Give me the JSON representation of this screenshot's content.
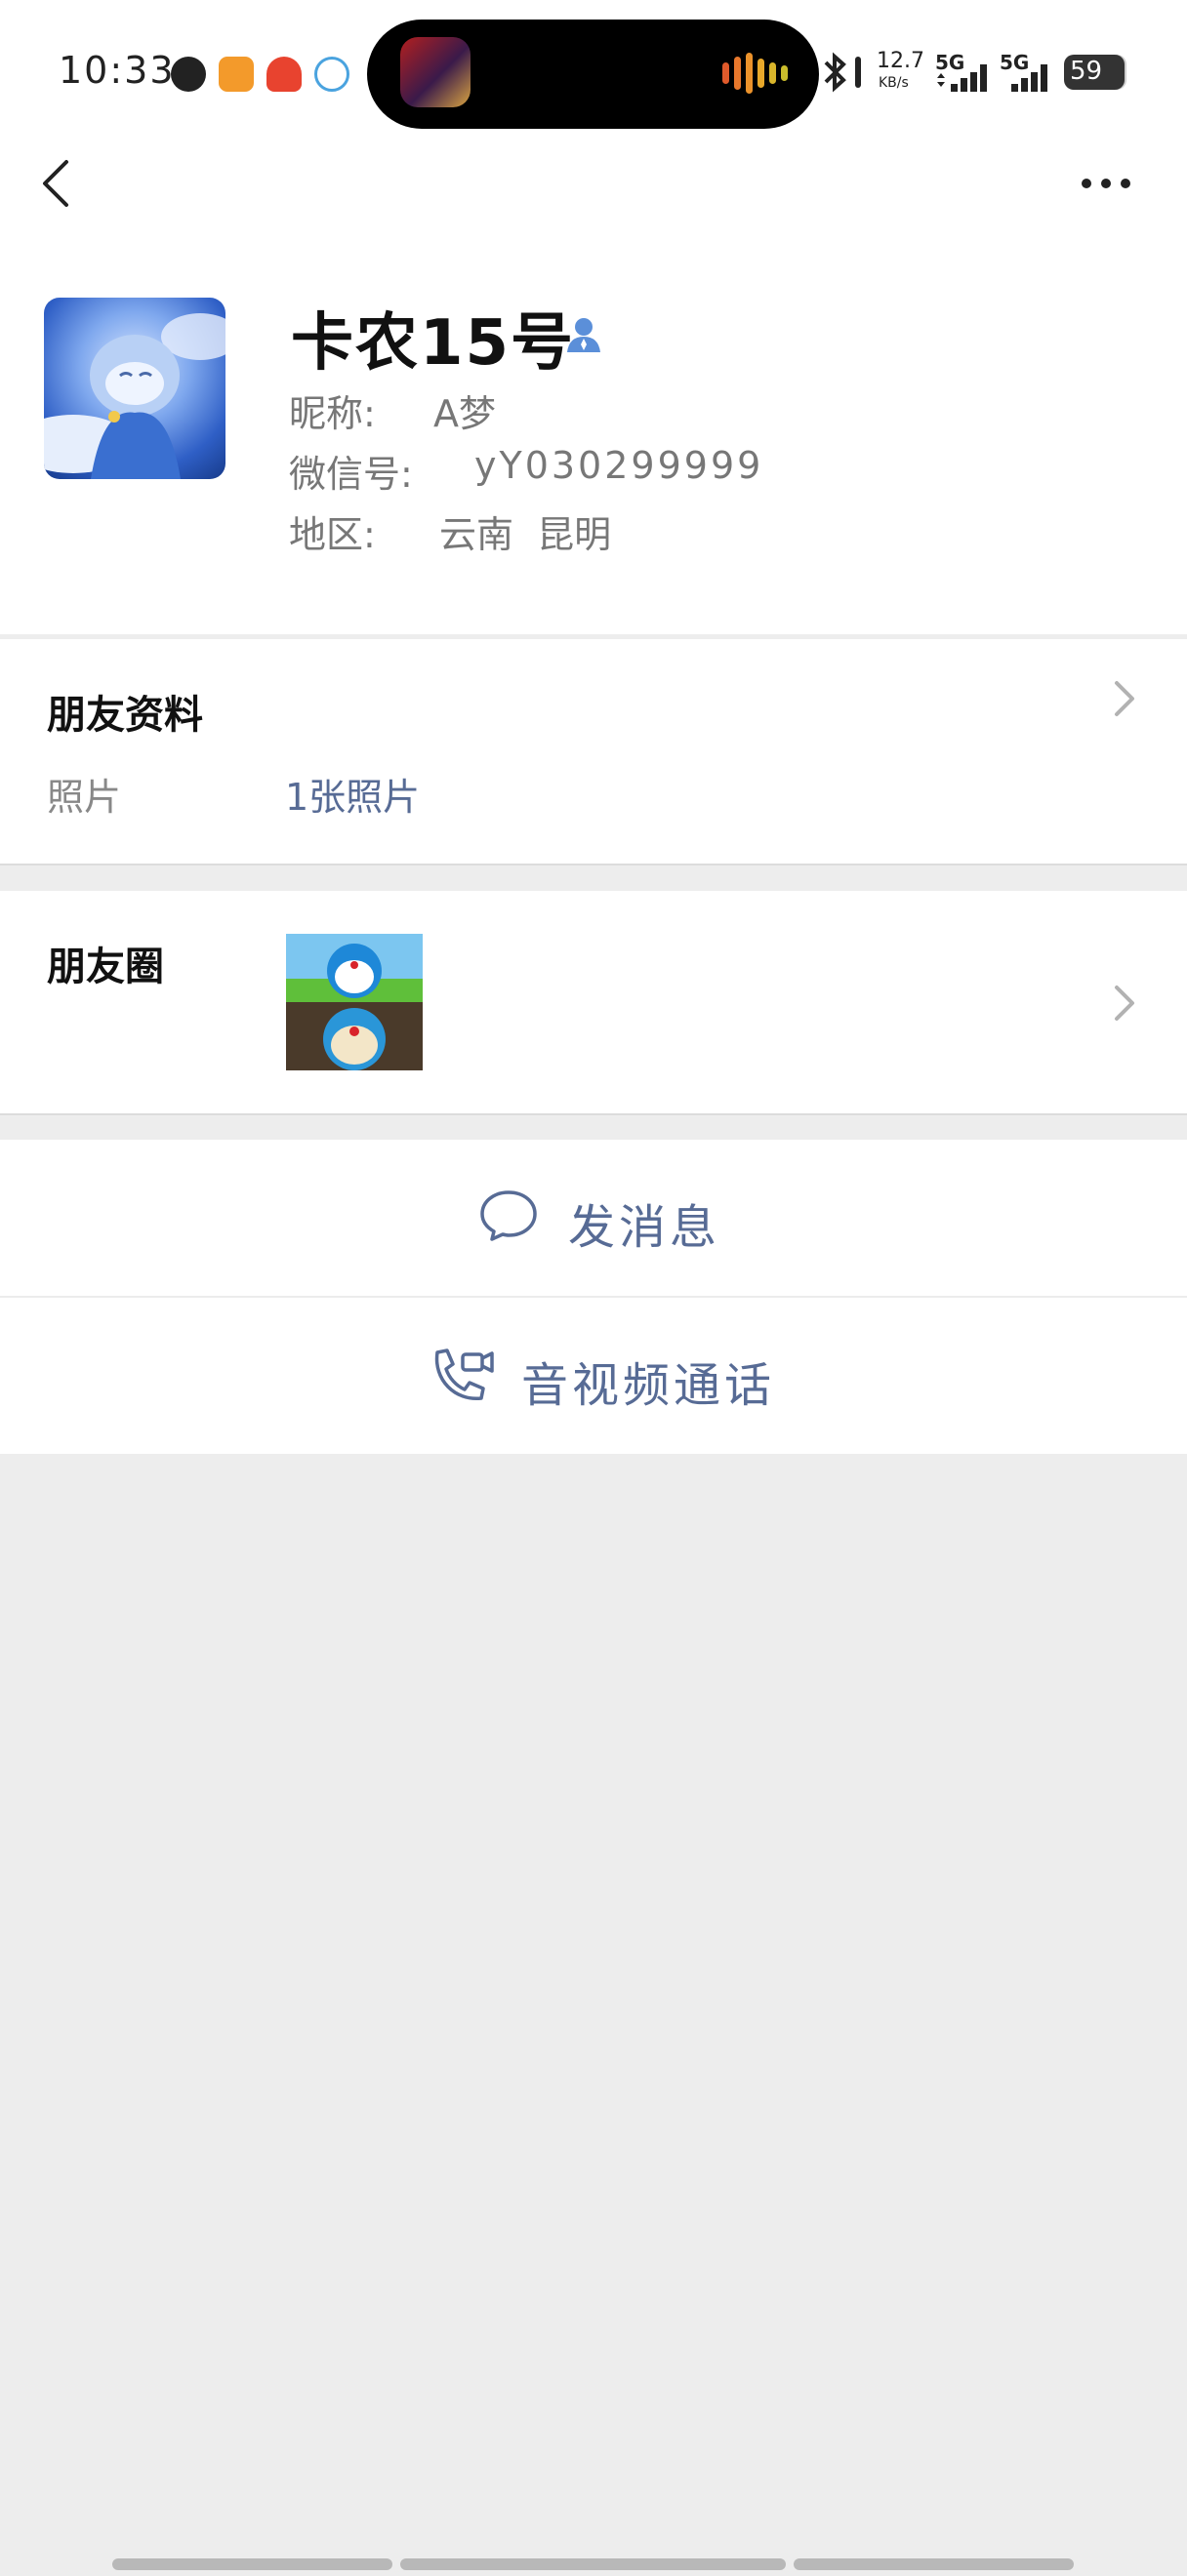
{
  "status_bar": {
    "time": "10:33",
    "network_speed": "12.7",
    "network_speed_unit": "KB/s",
    "sim1": "5G",
    "sim2": "5G",
    "battery": "59"
  },
  "profile": {
    "display_name": "卡农15号",
    "nickname_label": "昵称:",
    "nickname": "A梦",
    "wechat_id_label": "微信号:",
    "wechat_id": "yY030299999",
    "region_label": "地区:",
    "region": "云南  昆明"
  },
  "friend_info": {
    "title": "朋友资料",
    "photo_label": "照片",
    "photo_value": "1张照片"
  },
  "moments": {
    "title": "朋友圈"
  },
  "actions": {
    "message": "发消息",
    "call": "音视频通话"
  },
  "colors": {
    "link": "#576b95",
    "background": "#ededed",
    "card": "#ffffff"
  },
  "icons": [
    "back-arrow-icon",
    "more-icon",
    "contact-person-icon",
    "chevron-right-icon",
    "chat-bubble-icon",
    "phone-video-icon"
  ]
}
